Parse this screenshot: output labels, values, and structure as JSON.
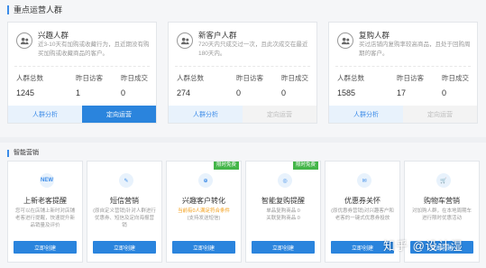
{
  "section1": {
    "title": "重点运营人群",
    "cards": [
      {
        "name": "兴趣人群",
        "desc": "近3-10天有加购或收藏行为，且近期没有购买加购或收藏商品的客户。",
        "stats": [
          {
            "label": "人群总数",
            "value": "1245"
          },
          {
            "label": "昨日访客",
            "value": "1"
          },
          {
            "label": "昨日成交",
            "value": "0"
          }
        ],
        "btn_analysis": "人群分析",
        "btn_operate": "定向运营",
        "operate_enabled": true
      },
      {
        "name": "新客户人群",
        "desc": "720天内只成交过一次，且此次成交在最近180天内。",
        "stats": [
          {
            "label": "人群总数",
            "value": "274"
          },
          {
            "label": "昨日访客",
            "value": "0"
          },
          {
            "label": "昨日成交",
            "value": "0"
          }
        ],
        "btn_analysis": "人群分析",
        "btn_operate": "定向运营",
        "operate_enabled": false
      },
      {
        "name": "复购人群",
        "desc": "买过店铺内复购率较高商品，且处于回购周期的客户。",
        "stats": [
          {
            "label": "人群总数",
            "value": "1585"
          },
          {
            "label": "昨日访客",
            "value": "17"
          },
          {
            "label": "昨日成交",
            "value": "0"
          }
        ],
        "btn_analysis": "人群分析",
        "btn_operate": "定向运营",
        "operate_enabled": false
      }
    ]
  },
  "section2": {
    "title": "智能营销",
    "cards": [
      {
        "icon_text": "NEW",
        "icon": "new-icon",
        "name": "上新老客提醒",
        "desc": "您可以在店铺上新时对店铺老客进行提醒，快速提升新品销量及评价",
        "highlight": "",
        "badge": "",
        "button": "立即创建"
      },
      {
        "icon_text": "✎",
        "icon": "sms-icon",
        "name": "短信营销",
        "desc": "(原自定义营销)针对人群进行优惠券、短信及定向海报营销",
        "highlight": "",
        "badge": "",
        "button": "立即创建"
      },
      {
        "icon_text": "⊕",
        "icon": "interest-icon",
        "name": "兴趣客户转化",
        "desc": "(支持发送短信)",
        "highlight": "当前有0人满足符合条件",
        "badge": "限时免费",
        "button": "立即创建"
      },
      {
        "icon_text": "◎",
        "icon": "repurchase-icon",
        "name": "智能复购提醒",
        "desc": "单品复购商品 0\n关联复购商品 0",
        "highlight": "",
        "badge": "限时免费",
        "button": "立即创建"
      },
      {
        "icon_text": "✉",
        "icon": "coupon-icon",
        "name": "优惠券关怀",
        "desc": "(原优惠券营销)对兴趣客户和老客的一键式优惠券投放",
        "highlight": "",
        "badge": "",
        "button": "立即创建"
      },
      {
        "icon_text": "🛒",
        "icon": "cart-icon",
        "name": "购物车营销",
        "desc": "对加购人群，在本地周期车进行限时优惠活动",
        "highlight": "",
        "badge": "",
        "button": "立即创建"
      }
    ]
  },
  "watermark": "知乎 @设计湿"
}
